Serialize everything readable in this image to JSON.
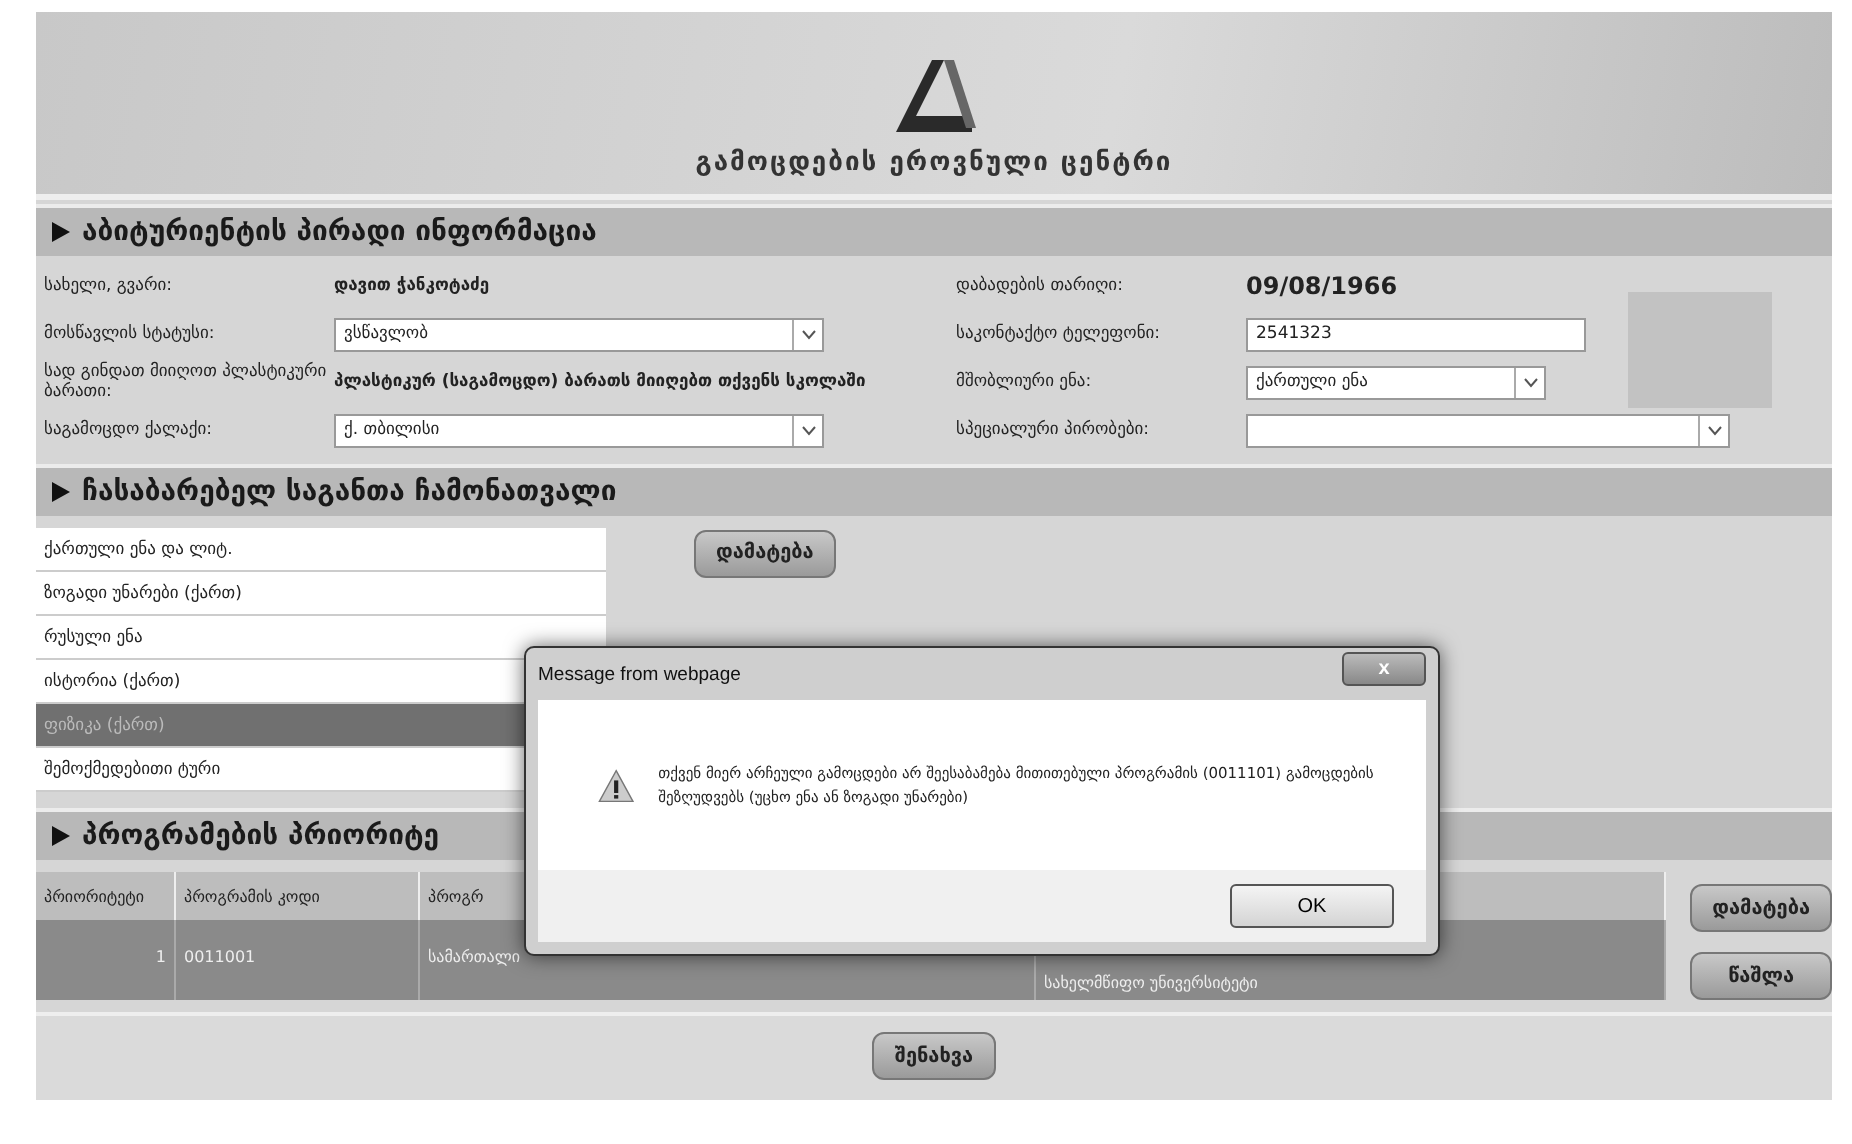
{
  "header": {
    "title": "გამოცდების ეროვნული ცენტრი"
  },
  "personal": {
    "heading": "აბიტურიენტის პირადი ინფორმაცია",
    "left": [
      {
        "kind": "text",
        "label": "სახელი, გვარი:",
        "value": "დავით ჭანკოტაძე"
      },
      {
        "kind": "select",
        "label": "მოსწავლის სტატუსი:",
        "value": "ვსწავლობ"
      },
      {
        "kind": "text",
        "label": "სად გინდათ მიიღოთ პლასტიკური ბარათი:",
        "value": "პლასტიკურ (საგამოცდო) ბარათს მიიღებთ თქვენს სკოლაში"
      },
      {
        "kind": "select",
        "label": "საგამოცდო ქალაქი:",
        "value": "ქ. თბილისი"
      }
    ],
    "right": [
      {
        "kind": "date",
        "label": "დაბადების თარიღი:",
        "value": "09/08/1966"
      },
      {
        "kind": "input",
        "label": "საკონტაქტო ტელეფონი:",
        "value": "2541323"
      },
      {
        "kind": "select",
        "label": "მშობლიური ენა:",
        "value": "ქართული ენა"
      },
      {
        "kind": "widebox",
        "label": "სპეციალური პირობები:"
      }
    ]
  },
  "subjects": {
    "heading": "ჩასაბარებელ საგანთა ჩამონათვალი",
    "items": [
      {
        "label": "ქართული ენა და ლიტ.",
        "selected": false
      },
      {
        "label": "ზოგადი უნარები (ქართ)",
        "selected": false
      },
      {
        "label": "რუსული ენა",
        "selected": false
      },
      {
        "label": "ისტორია (ქართ)",
        "selected": false
      },
      {
        "label": "ფიზიკა (ქართ)",
        "selected": true
      },
      {
        "label": "შემოქმედებითი ტური",
        "selected": false
      }
    ],
    "add_button": "დამატება"
  },
  "programs": {
    "heading": "პროგრამების პრიორიტე",
    "columns": [
      "პრიორიტეტი",
      "პროგრამის კოდი",
      "პროგრ"
    ],
    "rows": [
      {
        "selected": true,
        "cells": [
          "1",
          "0011001",
          "სამართალი",
          "სახელმწიფო უნივერსიტეტი"
        ]
      }
    ],
    "buttons": [
      "დამატება",
      "წაშლა"
    ]
  },
  "save_button": "შენახვა",
  "dialog": {
    "title": "Message from webpage",
    "close": "x",
    "message": "თქვენ მიერ არჩეული გამოცდები არ შეესაბამება მითითებული პროგრამის (0011101) გამოცდების შეზღუდვებს (უცხო ენა ან ზოგადი უნარები)",
    "ok": "OK"
  }
}
